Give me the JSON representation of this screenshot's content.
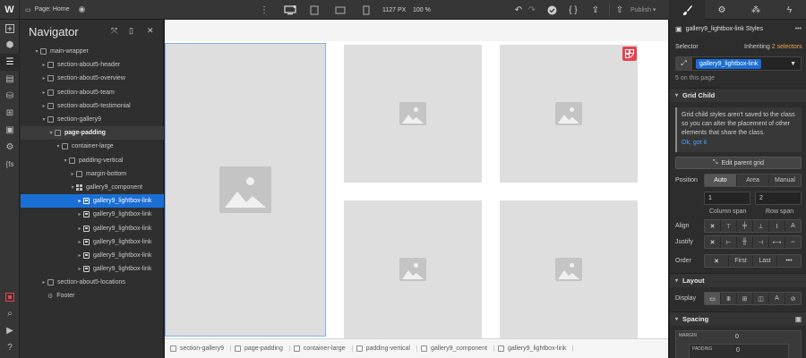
{
  "topbar": {
    "logo": "W",
    "page_label": "Page: Home",
    "width_px": "1127 PX",
    "zoom": "100 %",
    "publish": "Publish",
    "publish_caret": "▾"
  },
  "rail": {
    "items": [
      "add-icon",
      "cube-icon",
      "navigator-icon",
      "pages-icon",
      "cms-icon",
      "ecommerce-icon",
      "assets-icon",
      "settings-icon",
      "custom-code-icon"
    ],
    "bottom": [
      "record-icon",
      "search-icon",
      "video-icon",
      "help-icon"
    ]
  },
  "navigator": {
    "title": "Navigator",
    "rows": [
      {
        "label": "main-wrapper",
        "indent": 0,
        "caret": "▾",
        "icon": "box"
      },
      {
        "label": "section-about5-header",
        "indent": 1,
        "caret": "▸",
        "icon": "box"
      },
      {
        "label": "section-about5-overview",
        "indent": 1,
        "caret": "▸",
        "icon": "box"
      },
      {
        "label": "section-about5-team",
        "indent": 1,
        "caret": "▸",
        "icon": "box"
      },
      {
        "label": "section-about5-testimonial",
        "indent": 1,
        "caret": "▸",
        "icon": "box"
      },
      {
        "label": "section-gallery9",
        "indent": 1,
        "caret": "▾",
        "icon": "box"
      },
      {
        "label": "page-padding",
        "indent": 2,
        "caret": "▾",
        "icon": "box",
        "state": "highlight"
      },
      {
        "label": "container-large",
        "indent": 3,
        "caret": "▾",
        "icon": "box"
      },
      {
        "label": "padding-vertical",
        "indent": 4,
        "caret": "▾",
        "icon": "box"
      },
      {
        "label": "margin-bottom",
        "indent": 5,
        "caret": "▸",
        "icon": "box"
      },
      {
        "label": "gallery9_component",
        "indent": 5,
        "caret": "▾",
        "icon": "grid"
      },
      {
        "label": "gallery9_lightbox-link",
        "indent": 6,
        "caret": "▸",
        "icon": "link",
        "state": "selected"
      },
      {
        "label": "gallery9_lightbox-link",
        "indent": 6,
        "caret": "▸",
        "icon": "link"
      },
      {
        "label": "gallery9_lightbox-link",
        "indent": 6,
        "caret": "▸",
        "icon": "link"
      },
      {
        "label": "gallery9_lightbox-link",
        "indent": 6,
        "caret": "▸",
        "icon": "link"
      },
      {
        "label": "gallery9_lightbox-link",
        "indent": 6,
        "caret": "▸",
        "icon": "link"
      },
      {
        "label": "gallery9_lightbox-link",
        "indent": 6,
        "caret": "▸",
        "icon": "link"
      },
      {
        "label": "section-about5-locations",
        "indent": 1,
        "caret": "▸",
        "icon": "box"
      },
      {
        "label": "Footer",
        "indent": 1,
        "caret": "",
        "icon": "gear"
      }
    ]
  },
  "breadcrumb": [
    "section-gallery9",
    "page-padding",
    "container-large",
    "padding-vertical",
    "gallery9_component",
    "gallery9_lightbox-link"
  ],
  "style_panel": {
    "header_title": "gallery9_lightbox-link Styles",
    "more": "•••",
    "selector_label": "Selector",
    "inheriting": "Inheriting",
    "inheriting_count": "2 selectors",
    "selector_chip": "gallery9_lightbox-link",
    "on_page": "5 on this page",
    "grid_child": {
      "title": "Grid Child",
      "info": "Grid child styles aren't saved to the class so you can alter the placement of other elements that share the class.",
      "ok": "Ok, got it",
      "edit_parent": "Edit parent grid",
      "position_label": "Position",
      "position_options": [
        "Auto",
        "Area",
        "Manual"
      ],
      "column_span_value": "1",
      "row_span_value": "2",
      "column_span_label": "Column span",
      "row_span_label": "Row span",
      "align_label": "Align",
      "justify_label": "Justify",
      "order_label": "Order",
      "order_options": [
        "✕",
        "First",
        "Last",
        "•••"
      ]
    },
    "layout": {
      "title": "Layout",
      "display_label": "Display"
    },
    "spacing": {
      "title": "Spacing",
      "margin_label": "MARGIN",
      "margin_value": "0",
      "padding_label": "PADDING",
      "padding_value": "0"
    }
  }
}
